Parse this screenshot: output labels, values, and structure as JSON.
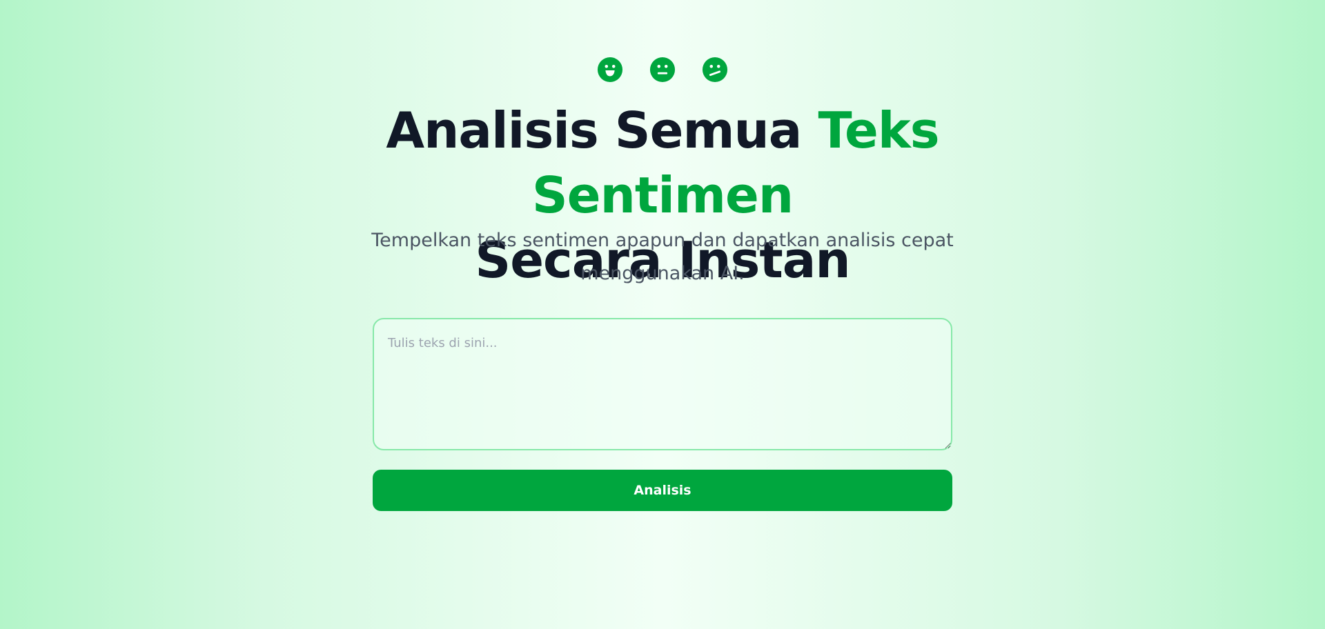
{
  "hero": {
    "icons": [
      "smiling-face-icon",
      "neutral-face-icon",
      "confused-face-icon"
    ],
    "headline": {
      "part1": "Analisis Semua ",
      "accent": "Teks Sentimen",
      "part2": "Secara Instan"
    },
    "subtitle": "Tempelkan teks sentimen apapun dan dapatkan analisis cepat menggunakan AI."
  },
  "form": {
    "input": {
      "placeholder": "Tulis teks di sini...",
      "value": ""
    },
    "button_label": "Analisis"
  },
  "colors": {
    "accent": "#00a63e",
    "heading": "#111827",
    "subtitle": "#4b5563",
    "input_border": "#86e8a8"
  }
}
